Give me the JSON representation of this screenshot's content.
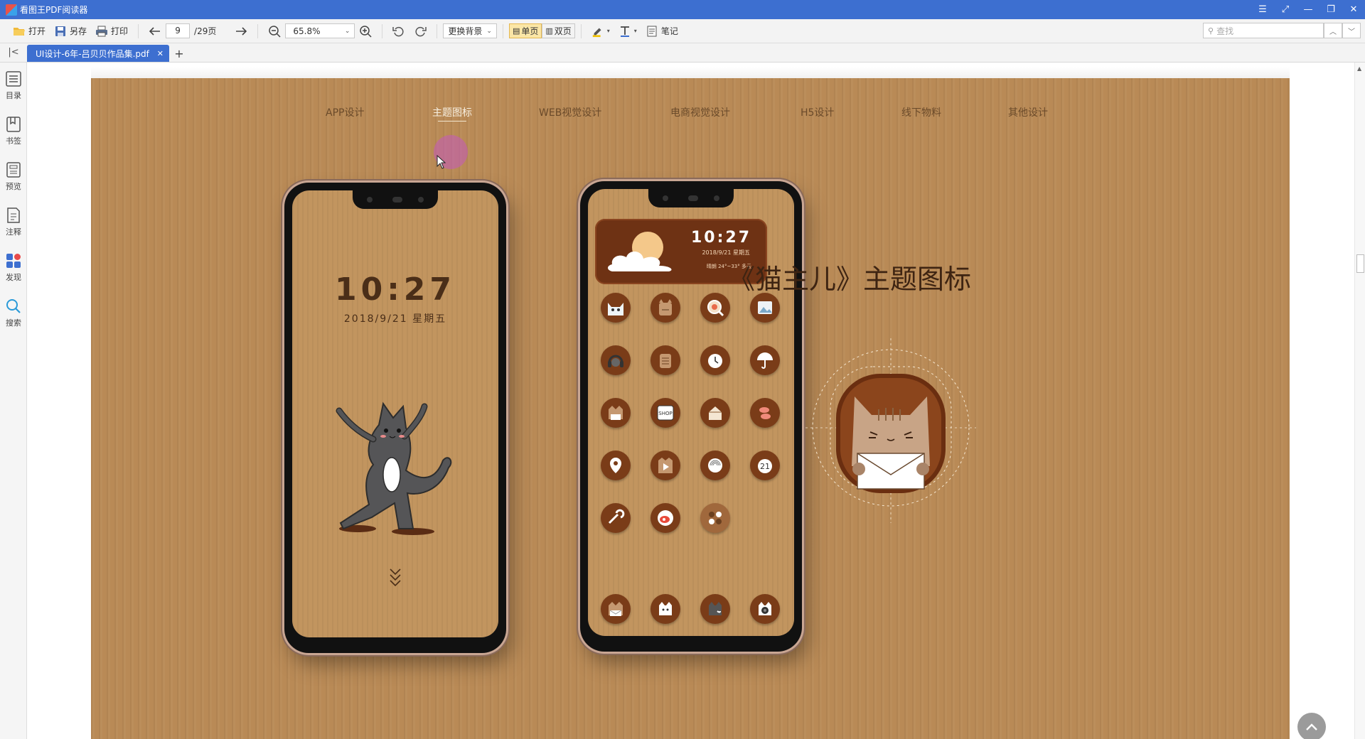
{
  "window": {
    "title": "看图王PDF阅读器",
    "logo_text": "PDF"
  },
  "toolbar": {
    "open_label": "打开",
    "saveas_label": "另存",
    "print_label": "打印",
    "page_current": "9",
    "page_total": "/29页",
    "zoom_value": "65.8%",
    "background_label": "更换背景",
    "single_page_label": "单页",
    "double_page_label": "双页",
    "notes_label": "笔记",
    "search_placeholder": "查找",
    "colors": {
      "accent": "#3d6fd0",
      "active_view": "#fbe6a6"
    }
  },
  "tabs": [
    {
      "label": "UI设计-6年-吕贝贝作品集.pdf",
      "active": true
    }
  ],
  "sidebar": {
    "items": [
      {
        "label": "目录",
        "icon": "toc-icon"
      },
      {
        "label": "书签",
        "icon": "bookmark-icon"
      },
      {
        "label": "预览",
        "icon": "preview-icon"
      },
      {
        "label": "注释",
        "icon": "annotation-icon"
      },
      {
        "label": "发现",
        "icon": "discover-icon"
      },
      {
        "label": "搜索",
        "icon": "search-icon"
      }
    ]
  },
  "document": {
    "nav": [
      {
        "label": "APP设计"
      },
      {
        "label": "主题图标",
        "active": true
      },
      {
        "label": "WEB视觉设计"
      },
      {
        "label": "电商视觉设计"
      },
      {
        "label": "H5设计"
      },
      {
        "label": "线下物料"
      },
      {
        "label": "其他设计"
      }
    ],
    "lockscreen": {
      "time": "10:27",
      "date": "2018/9/21  星期五"
    },
    "homescreen": {
      "widget_time": "10:27",
      "widget_date": "2018/9/21 星期五",
      "widget_temp": "晴朗 24°~33° 多云",
      "calendar_day": "21",
      "shop_text": "SHOP"
    },
    "headline": "《猫主儿》主题图标",
    "colors": {
      "page_bg": "#b98a56",
      "text_brown": "#3e2412"
    }
  }
}
